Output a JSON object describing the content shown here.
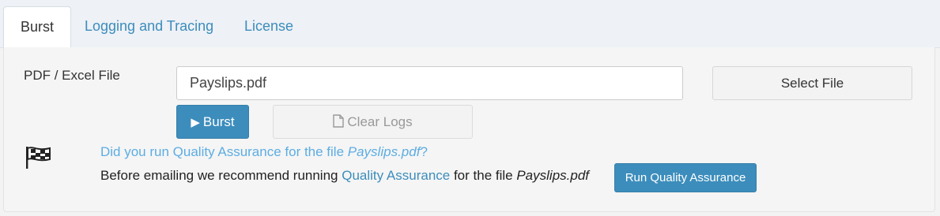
{
  "tabs": [
    {
      "label": "Burst",
      "active": true
    },
    {
      "label": "Logging and Tracing",
      "active": false
    },
    {
      "label": "License",
      "active": false
    }
  ],
  "burst": {
    "file_label": "PDF / Excel File",
    "file_value": "Payslips.pdf",
    "select_file_label": "Select File",
    "burst_button_label": "Burst",
    "clear_logs_label": "Clear Logs"
  },
  "qa": {
    "question_prefix": "Did you run Quality Assurance for the file ",
    "question_file": "Payslips.pdf",
    "question_suffix": "?",
    "line_prefix": "Before emailing we recommend running ",
    "line_link": "Quality Assurance",
    "line_middle": " for the file ",
    "line_file": "Payslips.pdf",
    "run_button_label": "Run Quality Assurance"
  },
  "colors": {
    "accent": "#3c8dbc",
    "link_light": "#5dade2",
    "tabbar_bg": "#eef1f6",
    "panel_bg": "#f5f5f5"
  },
  "icons": {
    "burst_button": "play-icon",
    "clear_logs_button": "file-icon",
    "qa_notice": "checkered-flag-icon"
  }
}
